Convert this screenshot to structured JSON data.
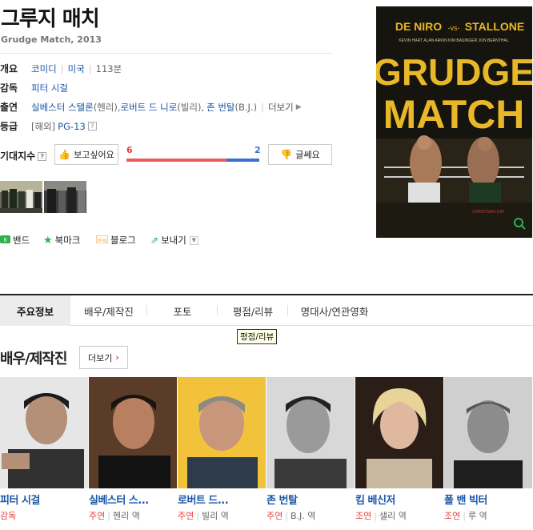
{
  "movie": {
    "title": "그루지 매치",
    "subtitle": "Grudge Match, 2013"
  },
  "info": {
    "overview_label": "개요",
    "genre": "코미디",
    "country": "미국",
    "runtime": "113분",
    "director_label": "감독",
    "director": "피터 시걸",
    "cast_label": "출연",
    "cast_1": "실베스터 스탤론",
    "cast_1_role": "(헨리), ",
    "cast_2": "로버트 드 니로",
    "cast_2_role": "(빌리), ",
    "cast_3": "존 번탈",
    "cast_3_role": "(B.J.)",
    "cast_more": "더보기",
    "rating_label": "등급",
    "rating_region": "[해외]",
    "rating": "PG-13"
  },
  "expect": {
    "label": "기대지수",
    "want_label": "보고싶어요",
    "meh_label": "글쎄요",
    "want_count": "6",
    "meh_count": "2",
    "want_ratio": 0.75
  },
  "share": {
    "band": "밴드",
    "bookmark": "북마크",
    "blog": "블로그",
    "send": "보내기"
  },
  "poster": {
    "top_name1": "DE NIRO",
    "top_vs": "-vs-",
    "top_name2": "STALLONE",
    "costars": "KEVIN HART   ALAN ARKIN   KIM BASINGER   JON BERNTHAL",
    "title1": "GRUDGE",
    "title2": "MATCH",
    "release": "CHRISTMAS DAY"
  },
  "tabs": [
    "주요정보",
    "배우/제작진",
    "포토",
    "평점/리뷰",
    "명대사/연관영화"
  ],
  "tooltip": "평점/리뷰",
  "section": {
    "title": "배우/제작진",
    "more": "더보기"
  },
  "cast_list": [
    {
      "name": "피터 시걸",
      "role": "감독",
      "character": ""
    },
    {
      "name": "실베스터 스...",
      "role": "주연",
      "character": "헨리 역"
    },
    {
      "name": "로버트 드...",
      "role": "주연",
      "character": "빌리 역"
    },
    {
      "name": "존 번탈",
      "role": "주연",
      "character": "B.J. 역"
    },
    {
      "name": "킴 베신저",
      "role": "조연",
      "character": "샐리 역"
    },
    {
      "name": "폴 밴 빅터",
      "role": "조연",
      "character": "루 역"
    }
  ],
  "colors": {
    "link": "#1a56a8",
    "accent_red": "#e8403e",
    "bar_red": "#f05a5a",
    "bar_blue": "#3a70d6",
    "poster_gold": "#e8b828"
  }
}
